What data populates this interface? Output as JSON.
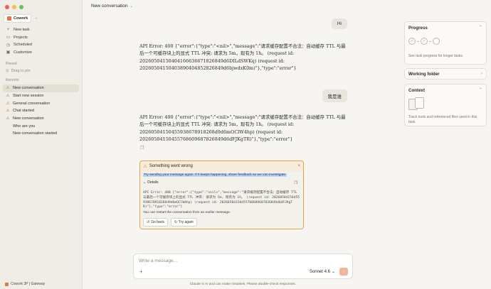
{
  "sidebar": {
    "brand": "Cowork",
    "nav": [
      {
        "label": "New task",
        "icon": "plus-icon"
      },
      {
        "label": "Projects",
        "icon": "folder-icon"
      },
      {
        "label": "Scheduled",
        "icon": "clock-icon"
      },
      {
        "label": "Customize",
        "icon": "customize-icon"
      }
    ],
    "pinned_label": "Pinned",
    "drag_to_pin": "Drag to pin",
    "recents_label": "Recents",
    "recents": [
      {
        "label": "New conversation",
        "status": "warning",
        "active": true
      },
      {
        "label": "Start new session",
        "status": "warning"
      },
      {
        "label": "General conversation",
        "status": "warning"
      },
      {
        "label": "Chat started",
        "status": "warning"
      },
      {
        "label": "New conversation",
        "status": "warning"
      },
      {
        "label": "Who are you",
        "status": "none"
      },
      {
        "label": "New conversation started",
        "status": "none"
      }
    ],
    "footer": "Cowork 3P | Gateway"
  },
  "header": {
    "title": "New conversation"
  },
  "conversation": {
    "user_message_1": "Hi",
    "assistant_message_1": "API Error: 400 {\"error\":{\"type\":\"<nil>\",\"message\":\"请求缓存配置不合法：自动缓存 TTL 与最后一个可缓存块上的显式 TTL 冲突: 请求为 5m，现有为 1h。 (request id: 20260504150404166636671826849d6DILdSWKq) (request id: 20260504150403890404852826849d6bjwdxK0m)\"},\"type\":\"error\"}",
    "user_message_2": "我是谁",
    "assistant_message_2": "API Error: 400 {\"error\":{\"type\":\"<nil>\",\"message\":\"请求缓存配置不合法：自动缓存 TTL 与最后一个可缓存块上的显式 TTL 冲突: 请求为 5m，现有为 1h。 (request id: 20260504150455938678918268d9d6mOClW4hp) (request id: 20260504150455768609687826849d6dFJKgTR)\"},\"type\":\"error\"}"
  },
  "error_card": {
    "title": "Something went wrong",
    "message": "Try sending your message again. If it keeps happening, share feedback so we can investigate.",
    "details_label": "Details",
    "details_text": "API Error: 400 {\"error\":{\"type\":\"<nil>\",\"message\":\"请求缓存配置不合法：自动缓存 TTL 与最后一个可缓存块上的显式 TTL 冲突: 请求为 5m, 现有为 1h。 (request id: 20260504150455938678918268d9d6mOClW4hp) (request id: 20260504150455768609687826849d6dFJKgTR)\"},\"type\":\"error\"}",
    "restart_note": "You can restart the conversation from an earlier message.",
    "go_back": "Go back",
    "try_again": "Try again"
  },
  "composer": {
    "placeholder": "Write a message...",
    "model": "Sonnet 4.6"
  },
  "disclaimer": "Claude is AI and can make mistakes. Please double-check responses.",
  "right_panel": {
    "progress_title": "Progress",
    "progress_desc": "See task progress for longer tasks.",
    "folder_title": "Working folder",
    "context_title": "Context",
    "context_desc": "Track tools and referenced files used in this task."
  },
  "colors": {
    "accent": "#d97757",
    "warning_border": "#e0a24a",
    "warning_bg": "#f7ecda",
    "send_button": "#f2b49b"
  }
}
